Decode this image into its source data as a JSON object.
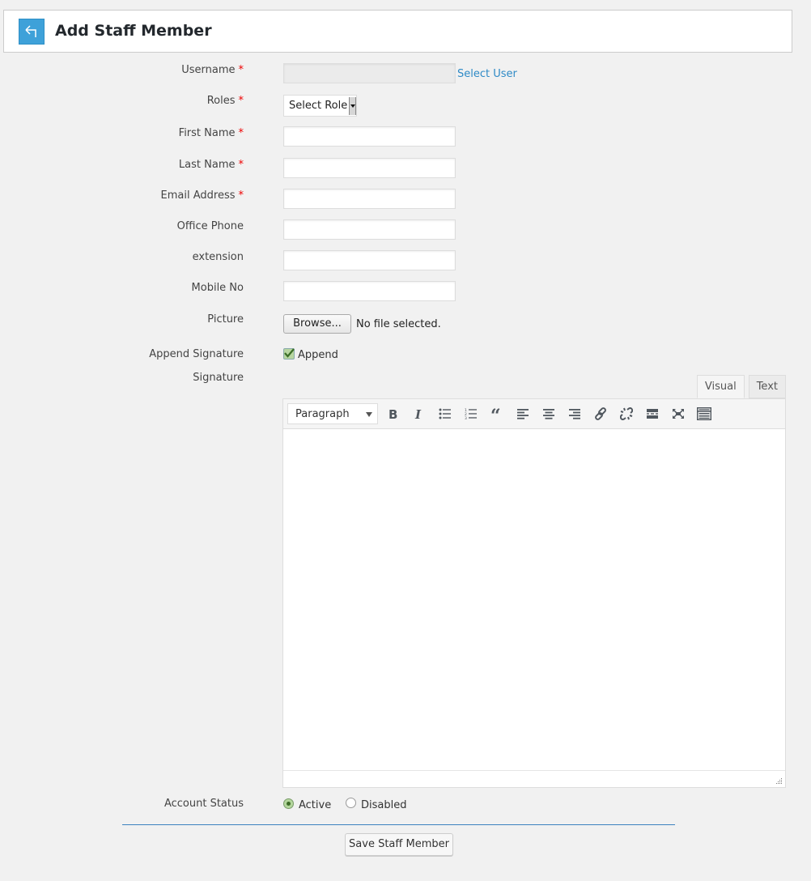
{
  "header": {
    "title": "Add Staff Member",
    "back_icon": "back-arrow-icon",
    "accent_color": "#3ea1d9"
  },
  "form": {
    "username": {
      "label": "Username",
      "required": "*",
      "value": "",
      "link": "Select User"
    },
    "roles": {
      "label": "Roles",
      "required": "*",
      "selected": "Select Role"
    },
    "first_name": {
      "label": "First Name",
      "required": "*",
      "value": ""
    },
    "last_name": {
      "label": "Last Name",
      "required": "*",
      "value": ""
    },
    "email": {
      "label": "Email Address",
      "required": "*",
      "value": ""
    },
    "office_phone": {
      "label": "Office Phone",
      "value": ""
    },
    "extension": {
      "label": "extension",
      "value": ""
    },
    "mobile": {
      "label": "Mobile No",
      "value": ""
    },
    "picture": {
      "label": "Picture",
      "button": "Browse...",
      "status": "No file selected."
    },
    "append_signature": {
      "label": "Append Signature",
      "checkbox_label": "Append",
      "checked": true
    },
    "signature": {
      "label": "Signature",
      "tabs": [
        {
          "label": "Visual",
          "active": true
        },
        {
          "label": "Text",
          "active": false
        }
      ],
      "format_select": "Paragraph",
      "toolbar": [
        "bold-icon",
        "italic-icon",
        "bullet-list-icon",
        "numbered-list-icon",
        "blockquote-icon",
        "align-left-icon",
        "align-center-icon",
        "align-right-icon",
        "link-icon",
        "unlink-icon",
        "read-more-icon",
        "fullscreen-icon",
        "toolbar-toggle-icon"
      ],
      "content": ""
    },
    "account_status": {
      "label": "Account Status",
      "options": [
        {
          "label": "Active",
          "selected": true
        },
        {
          "label": "Disabled",
          "selected": false
        }
      ]
    },
    "save_button": "Save Staff Member"
  }
}
